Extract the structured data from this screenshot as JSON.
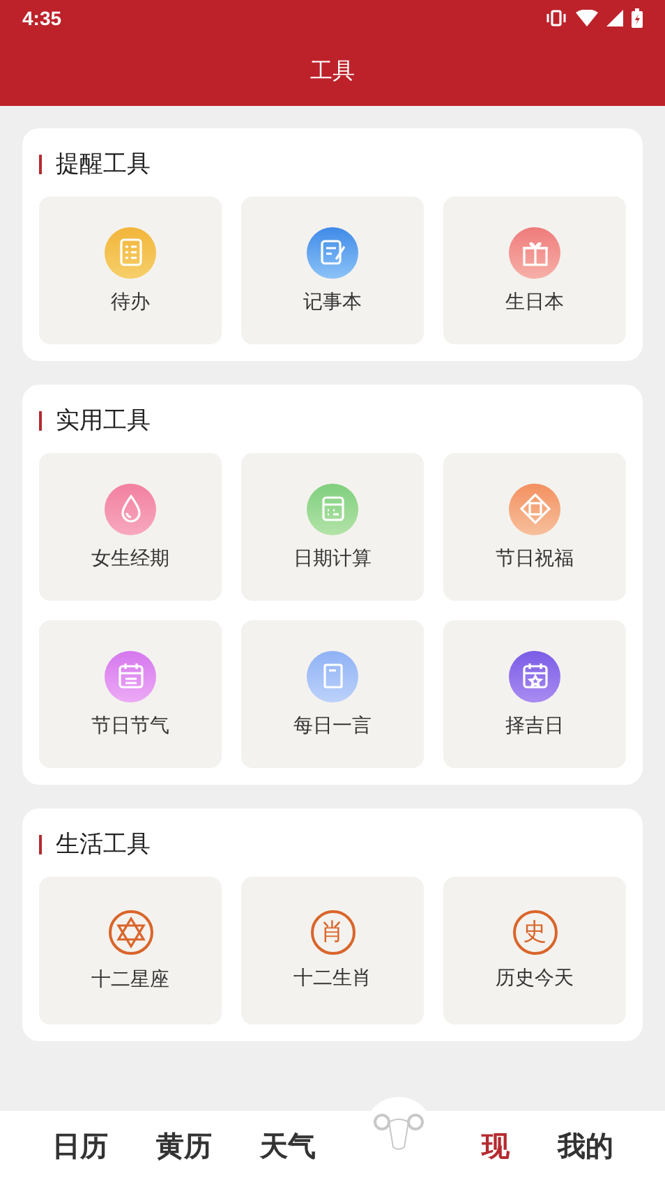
{
  "status_bar": {
    "time": "4:35"
  },
  "header": {
    "title": "工具"
  },
  "sections": [
    {
      "title": "提醒工具",
      "tools": [
        {
          "label": "待办",
          "kind": "todo"
        },
        {
          "label": "记事本",
          "kind": "note"
        },
        {
          "label": "生日本",
          "kind": "gift"
        }
      ]
    },
    {
      "title": "实用工具",
      "tools": [
        {
          "label": "女生经期",
          "kind": "drop"
        },
        {
          "label": "日期计算",
          "kind": "calc"
        },
        {
          "label": "节日祝福",
          "kind": "blessing"
        },
        {
          "label": "节日节气",
          "kind": "calendar"
        },
        {
          "label": "每日一言",
          "kind": "book"
        },
        {
          "label": "择吉日",
          "kind": "starcal"
        }
      ]
    },
    {
      "title": "生活工具",
      "tools": [
        {
          "label": "十二星座",
          "kind": "star"
        },
        {
          "label": "十二生肖",
          "kind": "seal",
          "glyph": "肖"
        },
        {
          "label": "历史今天",
          "kind": "seal",
          "glyph": "史"
        }
      ]
    }
  ],
  "tab_bar": [
    {
      "label": "日历",
      "selected": false
    },
    {
      "label": "黄历",
      "selected": false
    },
    {
      "label": "天气",
      "selected": false
    },
    {
      "kind": "mascot"
    },
    {
      "label": "现",
      "selected": true
    },
    {
      "label": "我的",
      "selected": false
    }
  ]
}
